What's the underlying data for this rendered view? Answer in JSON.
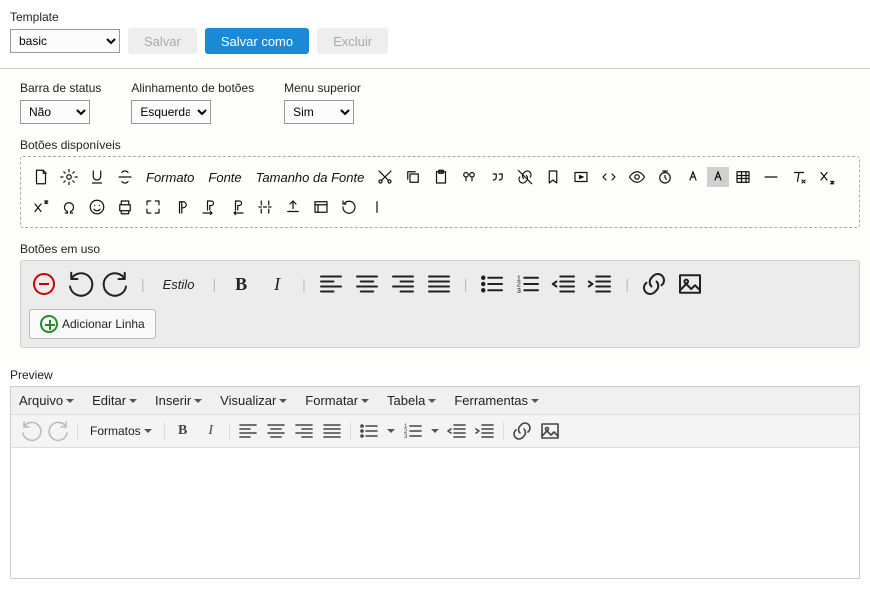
{
  "template": {
    "label": "Template",
    "value": "basic",
    "buttons": {
      "save": "Salvar",
      "save_as": "Salvar como",
      "delete": "Excluir"
    }
  },
  "config": {
    "status_bar": {
      "label": "Barra de status",
      "value": "Não"
    },
    "button_align": {
      "label": "Alinhamento de botões",
      "value": "Esquerda"
    },
    "top_menu": {
      "label": "Menu superior",
      "value": "Sim"
    }
  },
  "sections": {
    "available": "Botões disponíveis",
    "in_use": "Botões em uso"
  },
  "available_text": {
    "format": "Formato",
    "font": "Fonte",
    "font_size": "Tamanho da Fonte"
  },
  "in_use": {
    "style": "Estilo",
    "add_row": "Adicionar Linha"
  },
  "preview": {
    "label": "Preview",
    "menus": [
      "Arquivo",
      "Editar",
      "Inserir",
      "Visualizar",
      "Formatar",
      "Tabela",
      "Ferramentas"
    ],
    "formats": "Formatos"
  }
}
